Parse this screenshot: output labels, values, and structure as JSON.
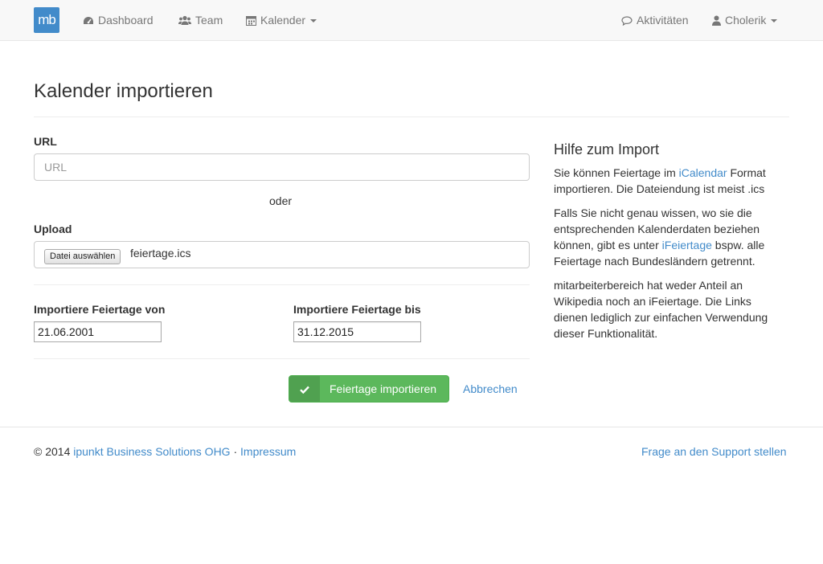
{
  "brand": {
    "logo_text": "mb",
    "color": "#428bca"
  },
  "nav": {
    "dashboard": {
      "label": "Dashboard",
      "icon": "dashboard-icon"
    },
    "team": {
      "label": "Team",
      "icon": "users-icon"
    },
    "calendar": {
      "label": "Kalender",
      "icon": "calendar-icon"
    },
    "activities": {
      "label": "Aktivitäten",
      "icon": "comment-icon"
    },
    "user": {
      "label": "Cholerik",
      "icon": "user-icon"
    }
  },
  "page": {
    "title": "Kalender importieren"
  },
  "form": {
    "url_label": "URL",
    "url_placeholder": "URL",
    "url_value": "",
    "or_text": "oder",
    "upload_label": "Upload",
    "file_button": "Datei auswählen",
    "file_name": "feiertage.ics",
    "from_label": "Importiere Feiertage von",
    "from_value": "21.06.2001",
    "to_label": "Importiere Feiertage bis",
    "to_value": "31.12.2015",
    "submit_label": "Feiertage importieren",
    "cancel_label": "Abbrechen"
  },
  "help": {
    "title": "Hilfe zum Import",
    "p1_before": "Sie können Feiertage im ",
    "p1_link": "iCalendar",
    "p1_after": " Format importieren. Die Dateiendung ist meist .ics",
    "p2_before": "Falls Sie nicht genau wissen, wo sie die entsprechenden Kalenderdaten beziehen können, gibt es unter ",
    "p2_link": "iFeiertage",
    "p2_after": " bspw. alle Feiertage nach Bundesländern getrennt.",
    "p3": "mitarbeiterbereich hat weder Anteil an Wikipedia noch an iFeiertage. Die Links dienen lediglich zur einfachen Verwendung dieser Funktionalität."
  },
  "footer": {
    "copyright": "© 2014 ",
    "company_link": "ipunkt Business Solutions OHG",
    "separator": " · ",
    "impressum_link": "Impressum",
    "support_link": "Frage an den Support stellen"
  },
  "colors": {
    "link": "#428bca",
    "success": "#5cb85c",
    "navbar_bg": "#f8f8f8"
  }
}
